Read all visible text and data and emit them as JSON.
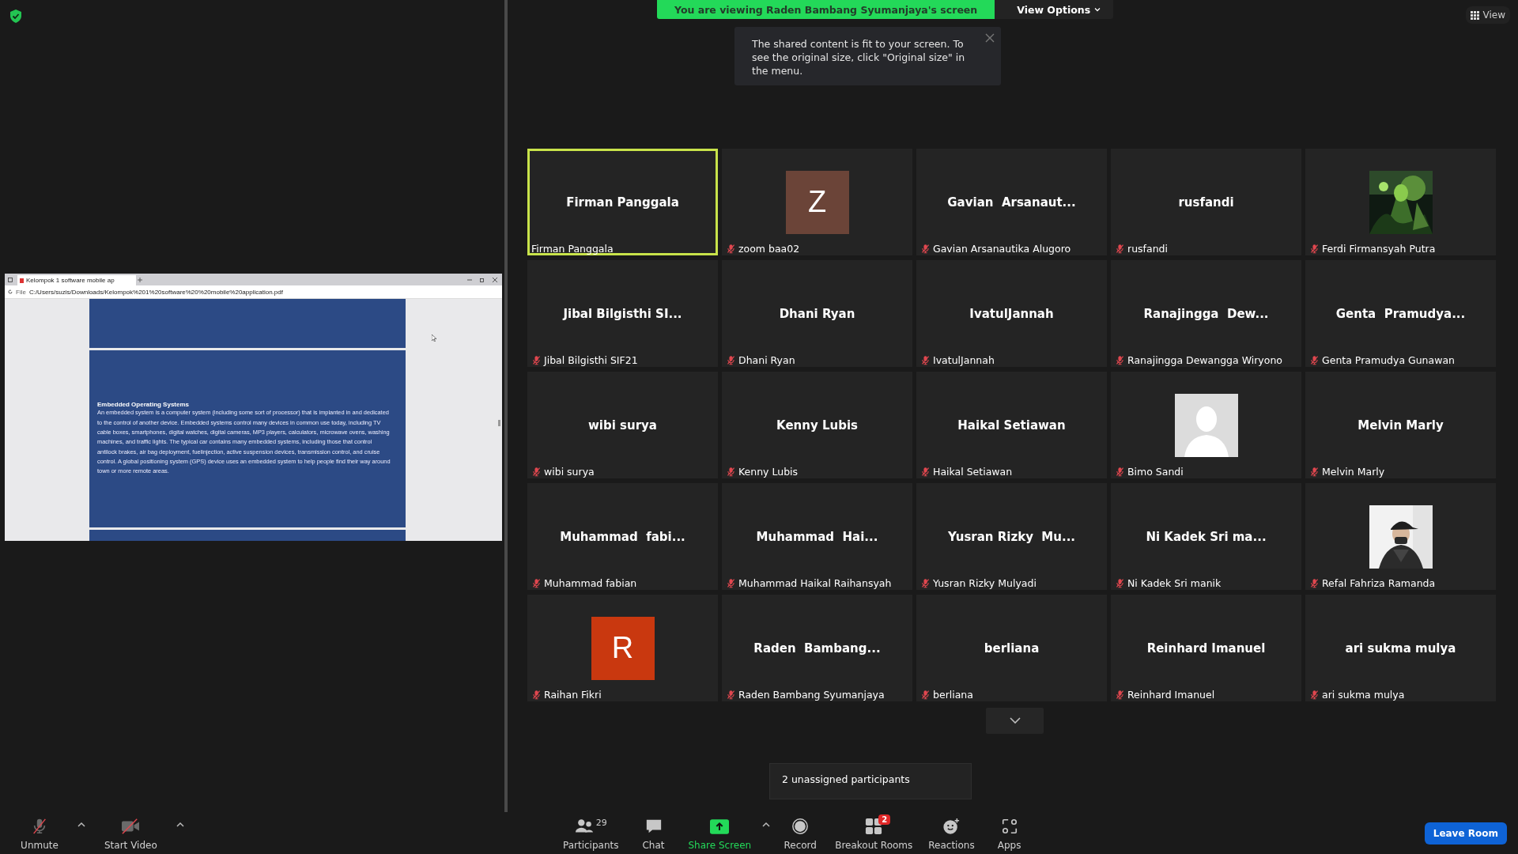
{
  "banner": {
    "text": "You are viewing Raden Bambang Syumanjaya's screen",
    "view_options": "View Options"
  },
  "notice": {
    "text": "The shared content is fit to your screen. To see the original size, click \"Original size\" in the menu."
  },
  "view_button": "View",
  "shared_screen": {
    "tab_title": "Kelompok 1 software mobile ap",
    "address_prefix": "File",
    "address": "C:/Users/suzis/Downloads/Kelompok%201%20software%20%20mobile%20application.pdf",
    "heading": "Embedded Operating Systems",
    "body": "An embedded system is a computer system (including some sort of processor) that is implanted in and dedicated to the control of another device. Embedded systems control many devices in common use today, including TV cable boxes, smartphones, digital watches, digital cameras, MP3 players, calculators, microwave ovens, washing machines, and traffic lights. The typical car contains many embedded systems, including those that control antilock brakes, air bag deployment, fuelinjection, active suspension devices, transmission control, and cruise control. A global positioning system (GPS) device uses an embedded system to help people find their way around town or more remote areas."
  },
  "participants": [
    {
      "tile_name": "Firman Panggala",
      "name": "Firman Panggala",
      "muted": false,
      "speaking": true,
      "kind": "name"
    },
    {
      "name": "zoom baa02",
      "muted": true,
      "speaking": false,
      "kind": "letter",
      "letter": "Z",
      "color": "#6b4438"
    },
    {
      "tile_name": "Gavian  Arsanaut...",
      "name": "Gavian Arsanautika Alugoro",
      "muted": true,
      "speaking": false,
      "kind": "name"
    },
    {
      "tile_name": "rusfandi",
      "name": "rusfandi",
      "muted": true,
      "speaking": false,
      "kind": "name"
    },
    {
      "name": "Ferdi Firmansyah Putra",
      "muted": true,
      "speaking": false,
      "kind": "picture"
    },
    {
      "tile_name": "Jibal Bilgisthi SI...",
      "name": "Jibal Bilgisthi SIF21",
      "muted": true,
      "speaking": false,
      "kind": "name"
    },
    {
      "tile_name": "Dhani Ryan",
      "name": "Dhani Ryan",
      "muted": true,
      "speaking": false,
      "kind": "name"
    },
    {
      "tile_name": "IvatulJannah",
      "name": "IvatulJannah",
      "muted": true,
      "speaking": false,
      "kind": "name"
    },
    {
      "tile_name": "Ranajingga  Dew...",
      "name": "Ranajingga Dewangga Wiryono",
      "muted": true,
      "speaking": false,
      "kind": "name"
    },
    {
      "tile_name": "Genta  Pramudya...",
      "name": "Genta Pramudya Gunawan",
      "muted": true,
      "speaking": false,
      "kind": "name"
    },
    {
      "tile_name": "wibi surya",
      "name": "wibi surya",
      "muted": true,
      "speaking": false,
      "kind": "name"
    },
    {
      "tile_name": "Kenny Lubis",
      "name": "Kenny Lubis",
      "muted": true,
      "speaking": false,
      "kind": "name"
    },
    {
      "tile_name": "Haikal Setiawan",
      "name": "Haikal Setiawan",
      "muted": true,
      "speaking": false,
      "kind": "name"
    },
    {
      "name": "Bimo Sandi",
      "muted": true,
      "speaking": false,
      "kind": "silhouette"
    },
    {
      "tile_name": "Melvin Marly",
      "name": "Melvin Marly",
      "muted": true,
      "speaking": false,
      "kind": "name"
    },
    {
      "tile_name": "Muhammad  fabi...",
      "name": "Muhammad fabian",
      "muted": true,
      "speaking": false,
      "kind": "name"
    },
    {
      "tile_name": "Muhammad  Hai...",
      "name": "Muhammad Haikal Raihansyah",
      "muted": true,
      "speaking": false,
      "kind": "name"
    },
    {
      "tile_name": "Yusran Rizky  Mu...",
      "name": "Yusran Rizky Mulyadi",
      "muted": true,
      "speaking": false,
      "kind": "name"
    },
    {
      "tile_name": "Ni Kadek Sri ma...",
      "name": "Ni Kadek Sri manik",
      "muted": true,
      "speaking": false,
      "kind": "name"
    },
    {
      "name": "Refal Fahriza Ramanda",
      "muted": true,
      "speaking": false,
      "kind": "picture"
    },
    {
      "name": "Raihan Fikri",
      "muted": true,
      "speaking": false,
      "kind": "letter",
      "letter": "R",
      "color": "#c9380f"
    },
    {
      "tile_name": "Raden  Bambang...",
      "name": "Raden Bambang Syumanjaya",
      "muted": true,
      "speaking": false,
      "kind": "name"
    },
    {
      "tile_name": "berliana",
      "name": "berliana",
      "muted": true,
      "speaking": false,
      "kind": "name"
    },
    {
      "tile_name": "Reinhard Imanuel",
      "name": "Reinhard Imanuel",
      "muted": true,
      "speaking": false,
      "kind": "name"
    },
    {
      "tile_name": "ari sukma mulya",
      "name": "ari sukma mulya",
      "muted": true,
      "speaking": false,
      "kind": "name"
    }
  ],
  "unassigned_tip": "2 unassigned participants",
  "toolbar": {
    "left": [
      {
        "label": "Unmute",
        "kind": "mic"
      },
      {
        "label": "Start Video",
        "kind": "video"
      }
    ],
    "center": [
      {
        "label": "Participants",
        "kind": "participants",
        "count": "29"
      },
      {
        "label": "Chat",
        "kind": "chat"
      },
      {
        "label": "Share Screen",
        "kind": "share"
      },
      {
        "label": "Record",
        "kind": "record"
      },
      {
        "label": "Breakout Rooms",
        "kind": "breakout",
        "badge": "2"
      },
      {
        "label": "Reactions",
        "kind": "reactions"
      },
      {
        "label": "Apps",
        "kind": "apps"
      }
    ],
    "leave": "Leave Room"
  }
}
